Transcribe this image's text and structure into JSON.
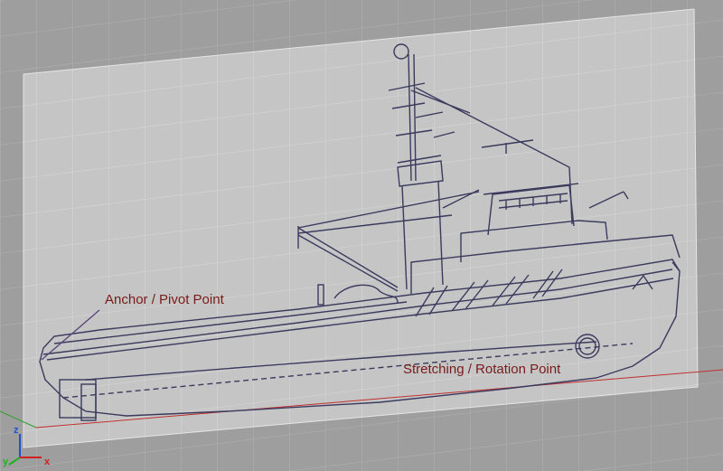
{
  "viewport": {
    "background_color": "#9e9e9e",
    "grid_color": "#b4b4b4",
    "plane_color": "#c9c9c9",
    "drawing_line_color": "#3b3a5e"
  },
  "annotations": {
    "anchor_label": "Anchor / Pivot Point",
    "stretch_label": "Stretching / Rotation Point",
    "label_color": "#7a1a1a"
  },
  "axis_triad": {
    "x_label": "x",
    "y_label": "y",
    "z_label": "z",
    "x_color": "#d02020",
    "y_color": "#20b020",
    "z_color": "#2050d0"
  }
}
